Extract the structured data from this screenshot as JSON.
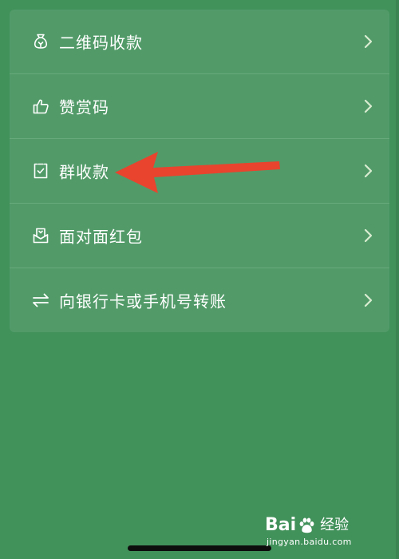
{
  "menu": {
    "items": [
      {
        "label": "二维码收款",
        "icon": "money-bag-icon"
      },
      {
        "label": "赞赏码",
        "icon": "thumbs-up-icon"
      },
      {
        "label": "群收款",
        "icon": "group-receipt-icon"
      },
      {
        "label": "面对面红包",
        "icon": "red-packet-icon"
      },
      {
        "label": "向银行卡或手机号转账",
        "icon": "transfer-arrows-icon"
      }
    ]
  },
  "annotation": {
    "arrow_color": "#e8442e",
    "points_to": "群收款"
  },
  "watermark": {
    "logo_text_1": "Bai",
    "logo_text_2": "经验",
    "url": "jingyan.baidu.com"
  },
  "colors": {
    "background": "#41915a",
    "card": "#529b69",
    "text": "#ffffff"
  }
}
